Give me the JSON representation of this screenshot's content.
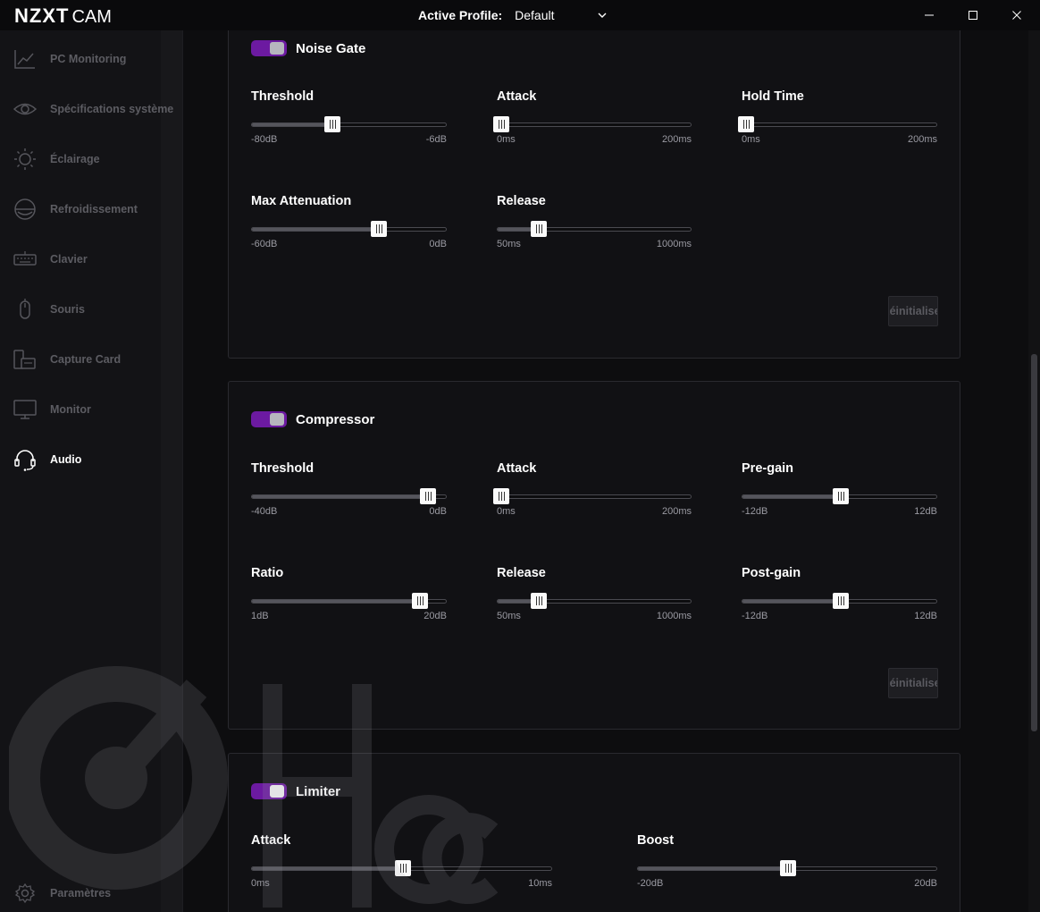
{
  "titlebar": {
    "logo_main": "NZXT",
    "logo_sub": "CAM",
    "profile_label": "Active Profile:",
    "profile_value": "Default"
  },
  "sidebar": {
    "items": [
      {
        "label": "PC Monitoring",
        "icon": "chart-line-icon"
      },
      {
        "label": "Spécifications système",
        "icon": "eye-icon"
      },
      {
        "label": "Éclairage",
        "icon": "sun-icon"
      },
      {
        "label": "Refroidissement",
        "icon": "fan-icon"
      },
      {
        "label": "Clavier",
        "icon": "keyboard-icon"
      },
      {
        "label": "Souris",
        "icon": "mouse-icon"
      },
      {
        "label": "Capture Card",
        "icon": "capture-card-icon"
      },
      {
        "label": "Monitor",
        "icon": "monitor-icon"
      },
      {
        "label": "Audio",
        "icon": "headset-icon",
        "active": true
      }
    ],
    "settings_label": "Paramètres"
  },
  "noise_gate": {
    "title": "Noise Gate",
    "enabled": true,
    "threshold": {
      "label": "Threshold",
      "min": "-80dB",
      "max": "-6dB",
      "value": 0.41
    },
    "attack": {
      "label": "Attack",
      "min": "0ms",
      "max": "200ms",
      "value": 0.02
    },
    "hold_time": {
      "label": "Hold Time",
      "min": "0ms",
      "max": "200ms",
      "value": 0.02
    },
    "max_attenuation": {
      "label": "Max Attenuation",
      "min": "-60dB",
      "max": "0dB",
      "value": 0.65
    },
    "release": {
      "label": "Release",
      "min": "50ms",
      "max": "1000ms",
      "value": 0.21
    },
    "reset_label": "Réinitialiser"
  },
  "compressor": {
    "title": "Compressor",
    "enabled": true,
    "threshold": {
      "label": "Threshold",
      "min": "-40dB",
      "max": "0dB",
      "value": 0.9
    },
    "attack": {
      "label": "Attack",
      "min": "0ms",
      "max": "200ms",
      "value": 0.02
    },
    "pre_gain": {
      "label": "Pre-gain",
      "min": "-12dB",
      "max": "12dB",
      "value": 0.5
    },
    "ratio": {
      "label": "Ratio",
      "min": "1dB",
      "max": "20dB",
      "value": 0.86
    },
    "release": {
      "label": "Release",
      "min": "50ms",
      "max": "1000ms",
      "value": 0.21
    },
    "post_gain": {
      "label": "Post-gain",
      "min": "-12dB",
      "max": "12dB",
      "value": 0.5
    },
    "reset_label": "Réinitialiser"
  },
  "limiter": {
    "title": "Limiter",
    "enabled": true,
    "attack": {
      "label": "Attack",
      "min": "0ms",
      "max": "10ms",
      "value": 0.5
    },
    "boost": {
      "label": "Boost",
      "min": "-20dB",
      "max": "20dB",
      "value": 0.5
    }
  },
  "colors": {
    "accent": "#6c1aa1",
    "background": "#0d0d0f",
    "panel": "#111114"
  }
}
